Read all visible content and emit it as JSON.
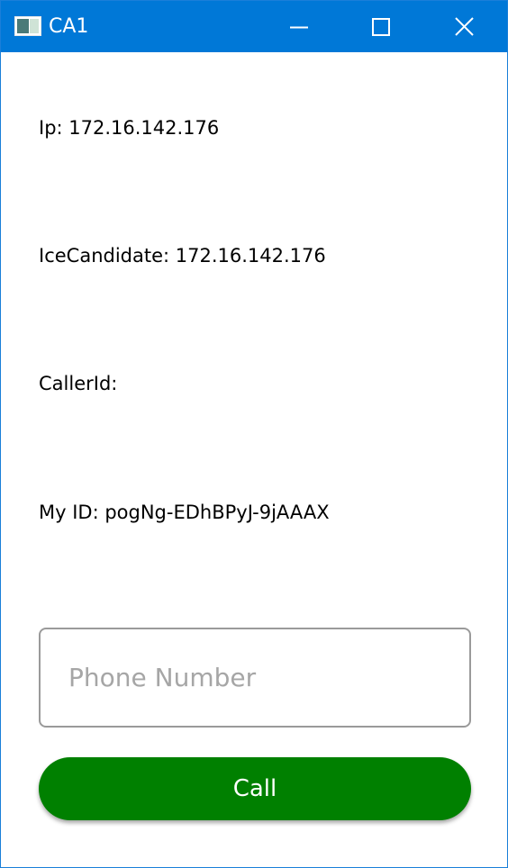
{
  "window": {
    "title": "CA1",
    "accent_color": "#0078d7",
    "controls": {
      "minimize_icon": "minimize-icon",
      "maximize_icon": "maximize-icon",
      "close_icon": "close-icon"
    }
  },
  "info": {
    "ip": "Ip: 172.16.142.176",
    "ice_candidate": "IceCandidate: 172.16.142.176",
    "caller_id": "CallerId:",
    "my_id": "My ID: pogNg-EDhBPyJ-9jAAAX"
  },
  "phone": {
    "value": "",
    "placeholder": "Phone Number"
  },
  "call": {
    "label": "Call",
    "color": "#008000"
  }
}
